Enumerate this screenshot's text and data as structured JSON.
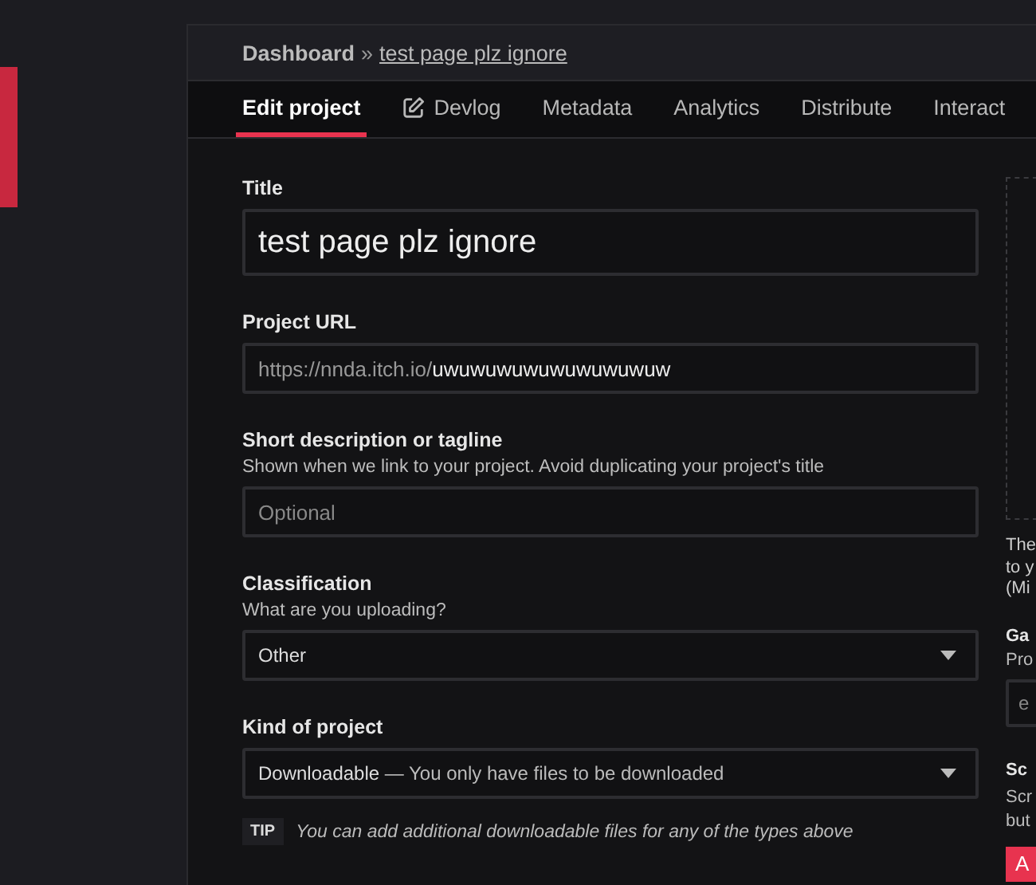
{
  "breadcrumb": {
    "root": "Dashboard",
    "separator": "»",
    "current": "test page plz ignore"
  },
  "tabs": [
    {
      "label": "Edit project",
      "selected": true,
      "kind": "plain"
    },
    {
      "label": "Devlog",
      "selected": false,
      "kind": "iconic"
    },
    {
      "label": "Metadata",
      "selected": false,
      "kind": "plain"
    },
    {
      "label": "Analytics",
      "selected": false,
      "kind": "plain"
    },
    {
      "label": "Distribute",
      "selected": false,
      "kind": "plain"
    },
    {
      "label": "Interact",
      "selected": false,
      "kind": "plain"
    }
  ],
  "form": [
    {
      "kind": "title",
      "label": "Title",
      "value": "test page plz ignore"
    },
    {
      "kind": "url",
      "label": "Project URL",
      "prefix": "https://nnda.itch.io/",
      "value": "uwuwuwuwuwuwuwuwuw"
    },
    {
      "kind": "text",
      "label": "Short description or tagline",
      "help": "Shown when we link to your project. Avoid duplicating your project's title",
      "placeholder": "Optional"
    },
    {
      "kind": "select",
      "label": "Classification",
      "help": "What are you uploading?",
      "value": "Other"
    },
    {
      "kind": "select",
      "label": "Kind of project",
      "value": "Downloadable",
      "detail": "— You only have files to be downloaded"
    }
  ],
  "tip": {
    "badge": "TIP",
    "text": "You can add additional downloadable files for any of the types above"
  },
  "side": {
    "cover_note": [
      "The",
      "to y",
      "(Mi"
    ],
    "gameplay_label": "Ga",
    "gameplay_help": "Pro",
    "gameplay_placeholder": "e",
    "screens_label": "Sc",
    "screens_help": [
      "Scr",
      "but"
    ],
    "add_button": "A"
  }
}
